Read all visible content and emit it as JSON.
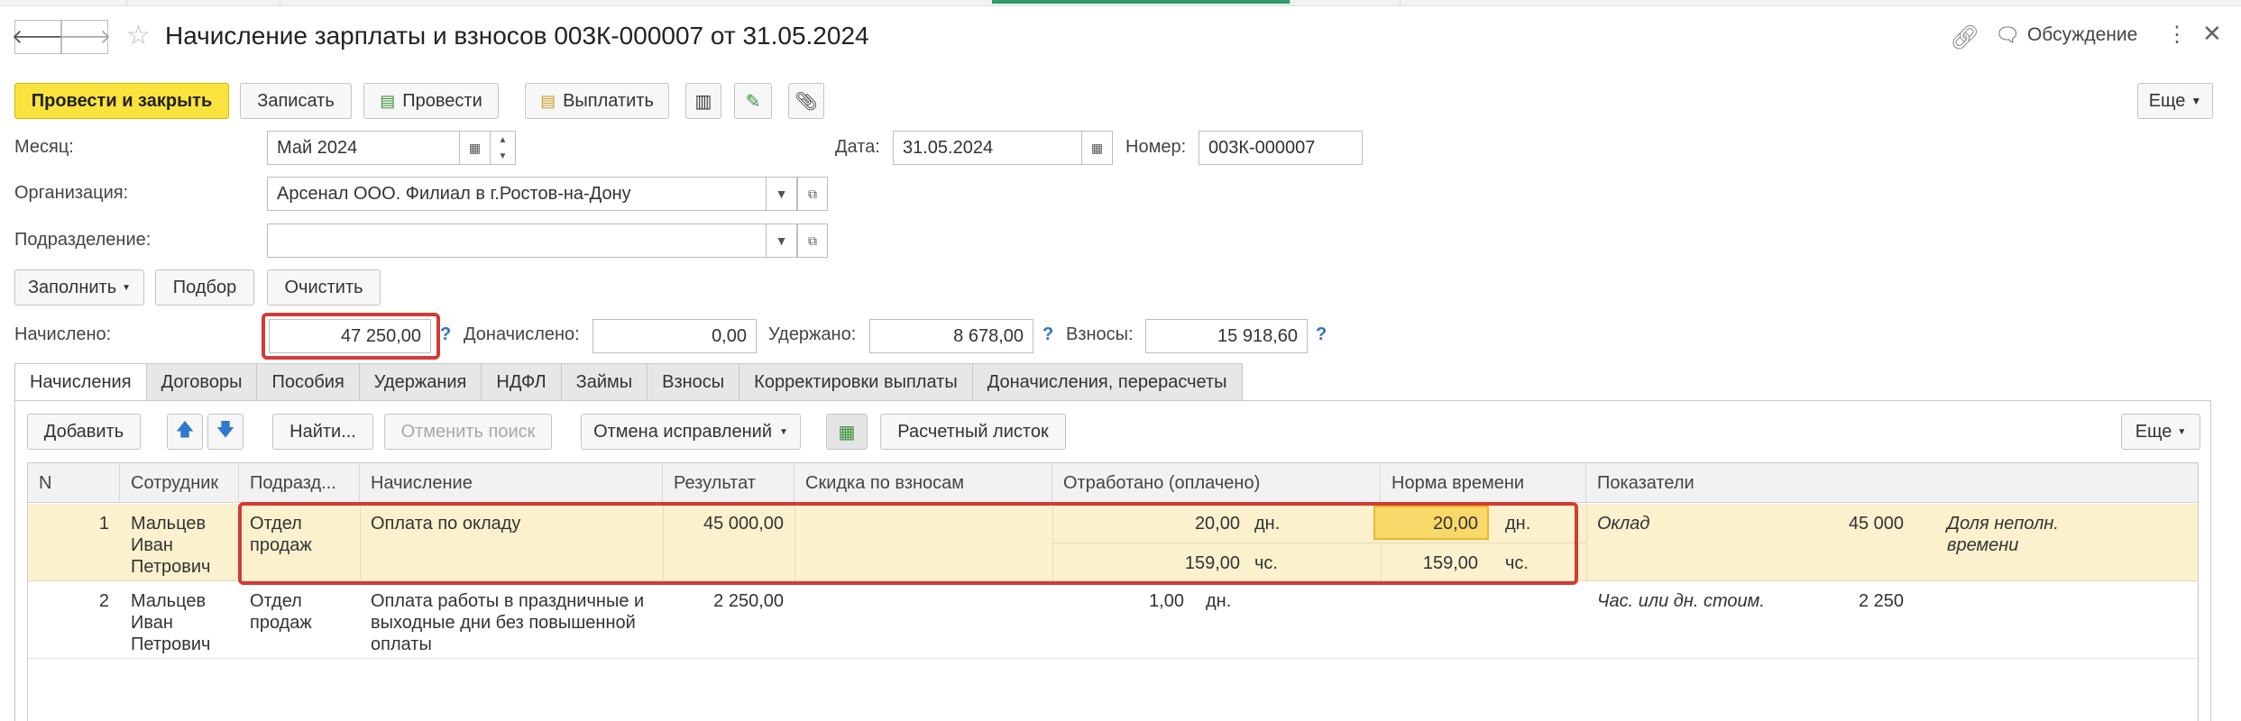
{
  "window": {
    "title": "Начисление зарплаты и взносов 003К-000007 от 31.05.2024",
    "discuss_label": "Обсуждение",
    "icons": {
      "back": "arrow-left-icon",
      "forward": "arrow-right-icon",
      "favorite": "star-icon",
      "link": "link-icon",
      "more": "kebab-icon",
      "close": "close-icon"
    }
  },
  "toolbar": {
    "post_close": "Провести и закрыть",
    "save": "Записать",
    "post": "Провести",
    "pay": "Выплатить",
    "more": "Еще"
  },
  "header": {
    "month_label": "Месяц:",
    "month_value": "Май 2024",
    "date_label": "Дата:",
    "date_value": "31.05.2024",
    "number_label": "Номер:",
    "number_value": "003К-000007",
    "org_label": "Организация:",
    "org_value": "Арсенал ООО. Филиал в г.Ростов-на-Дону",
    "dept_label": "Подразделение:",
    "dept_value": ""
  },
  "actions": {
    "fill": "Заполнить",
    "pick": "Подбор",
    "clear": "Очистить"
  },
  "totals": {
    "accrued_label": "Начислено:",
    "accrued_value": "47 250,00",
    "extra_label": "Доначислено:",
    "extra_value": "0,00",
    "withheld_label": "Удержано:",
    "withheld_value": "8 678,00",
    "contrib_label": "Взносы:",
    "contrib_value": "15 918,60",
    "hint": "?"
  },
  "tabs": [
    "Начисления",
    "Договоры",
    "Пособия",
    "Удержания",
    "НДФЛ",
    "Займы",
    "Взносы",
    "Корректировки выплаты",
    "Доначисления, перерасчеты"
  ],
  "table_toolbar": {
    "add": "Добавить",
    "find": "Найти...",
    "cancel_search": "Отменить поиск",
    "cancel_fix": "Отмена исправлений",
    "payslip": "Расчетный листок",
    "more": "Еще"
  },
  "table": {
    "columns": [
      "N",
      "Сотрудник",
      "Подразд...",
      "Начисление",
      "Результат",
      "Скидка по взносам",
      "Отработано (оплачено)",
      "Норма времени",
      "Показатели"
    ],
    "rows": [
      {
        "n": "1",
        "employee": [
          "Мальцев",
          "Иван",
          "Петрович"
        ],
        "dept": [
          "Отдел",
          "продаж"
        ],
        "accrual": [
          "Оплата по окладу"
        ],
        "result": "45 000,00",
        "worked_days": "20,00",
        "worked_days_unit": "дн.",
        "worked_hours": "159,00",
        "worked_hours_unit": "чс.",
        "norm_days": "20,00",
        "norm_days_unit": "дн.",
        "norm_hours": "159,00",
        "norm_hours_unit": "чс.",
        "indicator_name": "Оклад",
        "indicator_value": "45 000",
        "indicator_extra": [
          "Доля неполн.",
          "времени"
        ]
      },
      {
        "n": "2",
        "employee": [
          "Мальцев",
          "Иван",
          "Петрович"
        ],
        "dept": [
          "Отдел",
          "продаж"
        ],
        "accrual": [
          "Оплата работы в праздничные и",
          "выходные дни без повышенной",
          "оплаты"
        ],
        "result": "2 250,00",
        "worked_days": "1,00",
        "worked_days_unit": "дн.",
        "indicator_name": "Час. или дн. стоим.",
        "indicator_value": "2 250"
      }
    ]
  }
}
